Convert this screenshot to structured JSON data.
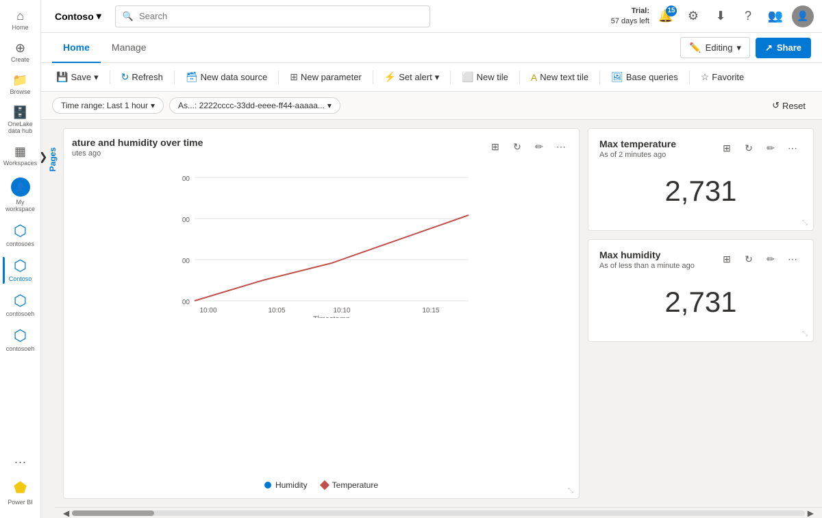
{
  "workspace": {
    "name": "Contoso",
    "chevron": "▾"
  },
  "search": {
    "placeholder": "Search"
  },
  "trial": {
    "label": "Trial:",
    "days_left": "57 days left"
  },
  "notification": {
    "count": "15"
  },
  "tabs": {
    "home_label": "Home",
    "manage_label": "Manage",
    "editing_label": "Editing",
    "share_label": "Share"
  },
  "toolbar": {
    "save_label": "Save",
    "refresh_label": "Refresh",
    "new_datasource_label": "New data source",
    "new_parameter_label": "New parameter",
    "set_alert_label": "Set alert",
    "new_tile_label": "New tile",
    "new_text_tile_label": "New text tile",
    "base_queries_label": "Base queries",
    "favorite_label": "Favorite"
  },
  "filters": {
    "time_range_label": "Time range: Last 1 hour",
    "asset_label": "As...: 2222cccc-33dd-eeee-ff44-aaaaa...",
    "reset_label": "Reset"
  },
  "sidebar_nav": {
    "home_label": "Home",
    "create_label": "Create",
    "browse_label": "Browse",
    "onelake_label": "OneLake data hub",
    "workspaces_label": "Workspaces",
    "my_workspace_label": "My workspace",
    "contosoes_label": "contosoes",
    "contoso_label": "Contoso",
    "contosoeh1_label": "contosoeh",
    "contosoeh2_label": "contosoeh",
    "more_label": "...",
    "powerbi_label": "Power BI"
  },
  "pages_label": "Pages",
  "chart": {
    "title": "ature and humidity over time",
    "subtitle": "utes ago",
    "x_label": "Timestamp",
    "x_ticks": [
      "10:00",
      "10:05",
      "10:10",
      "10:15"
    ],
    "y_ticks": [
      "00",
      "00",
      "00",
      "00"
    ],
    "legend": [
      {
        "label": "Humidity",
        "color": "#0078d4",
        "shape": "dot"
      },
      {
        "label": "Temperature",
        "color": "#c0504d",
        "shape": "diamond"
      }
    ]
  },
  "kpi_max_temp": {
    "title": "Max temperature",
    "subtitle": "As of 2 minutes ago",
    "value": "2,731"
  },
  "kpi_max_humidity": {
    "title": "Max humidity",
    "subtitle": "As of less than a minute ago",
    "value": "2,731"
  }
}
